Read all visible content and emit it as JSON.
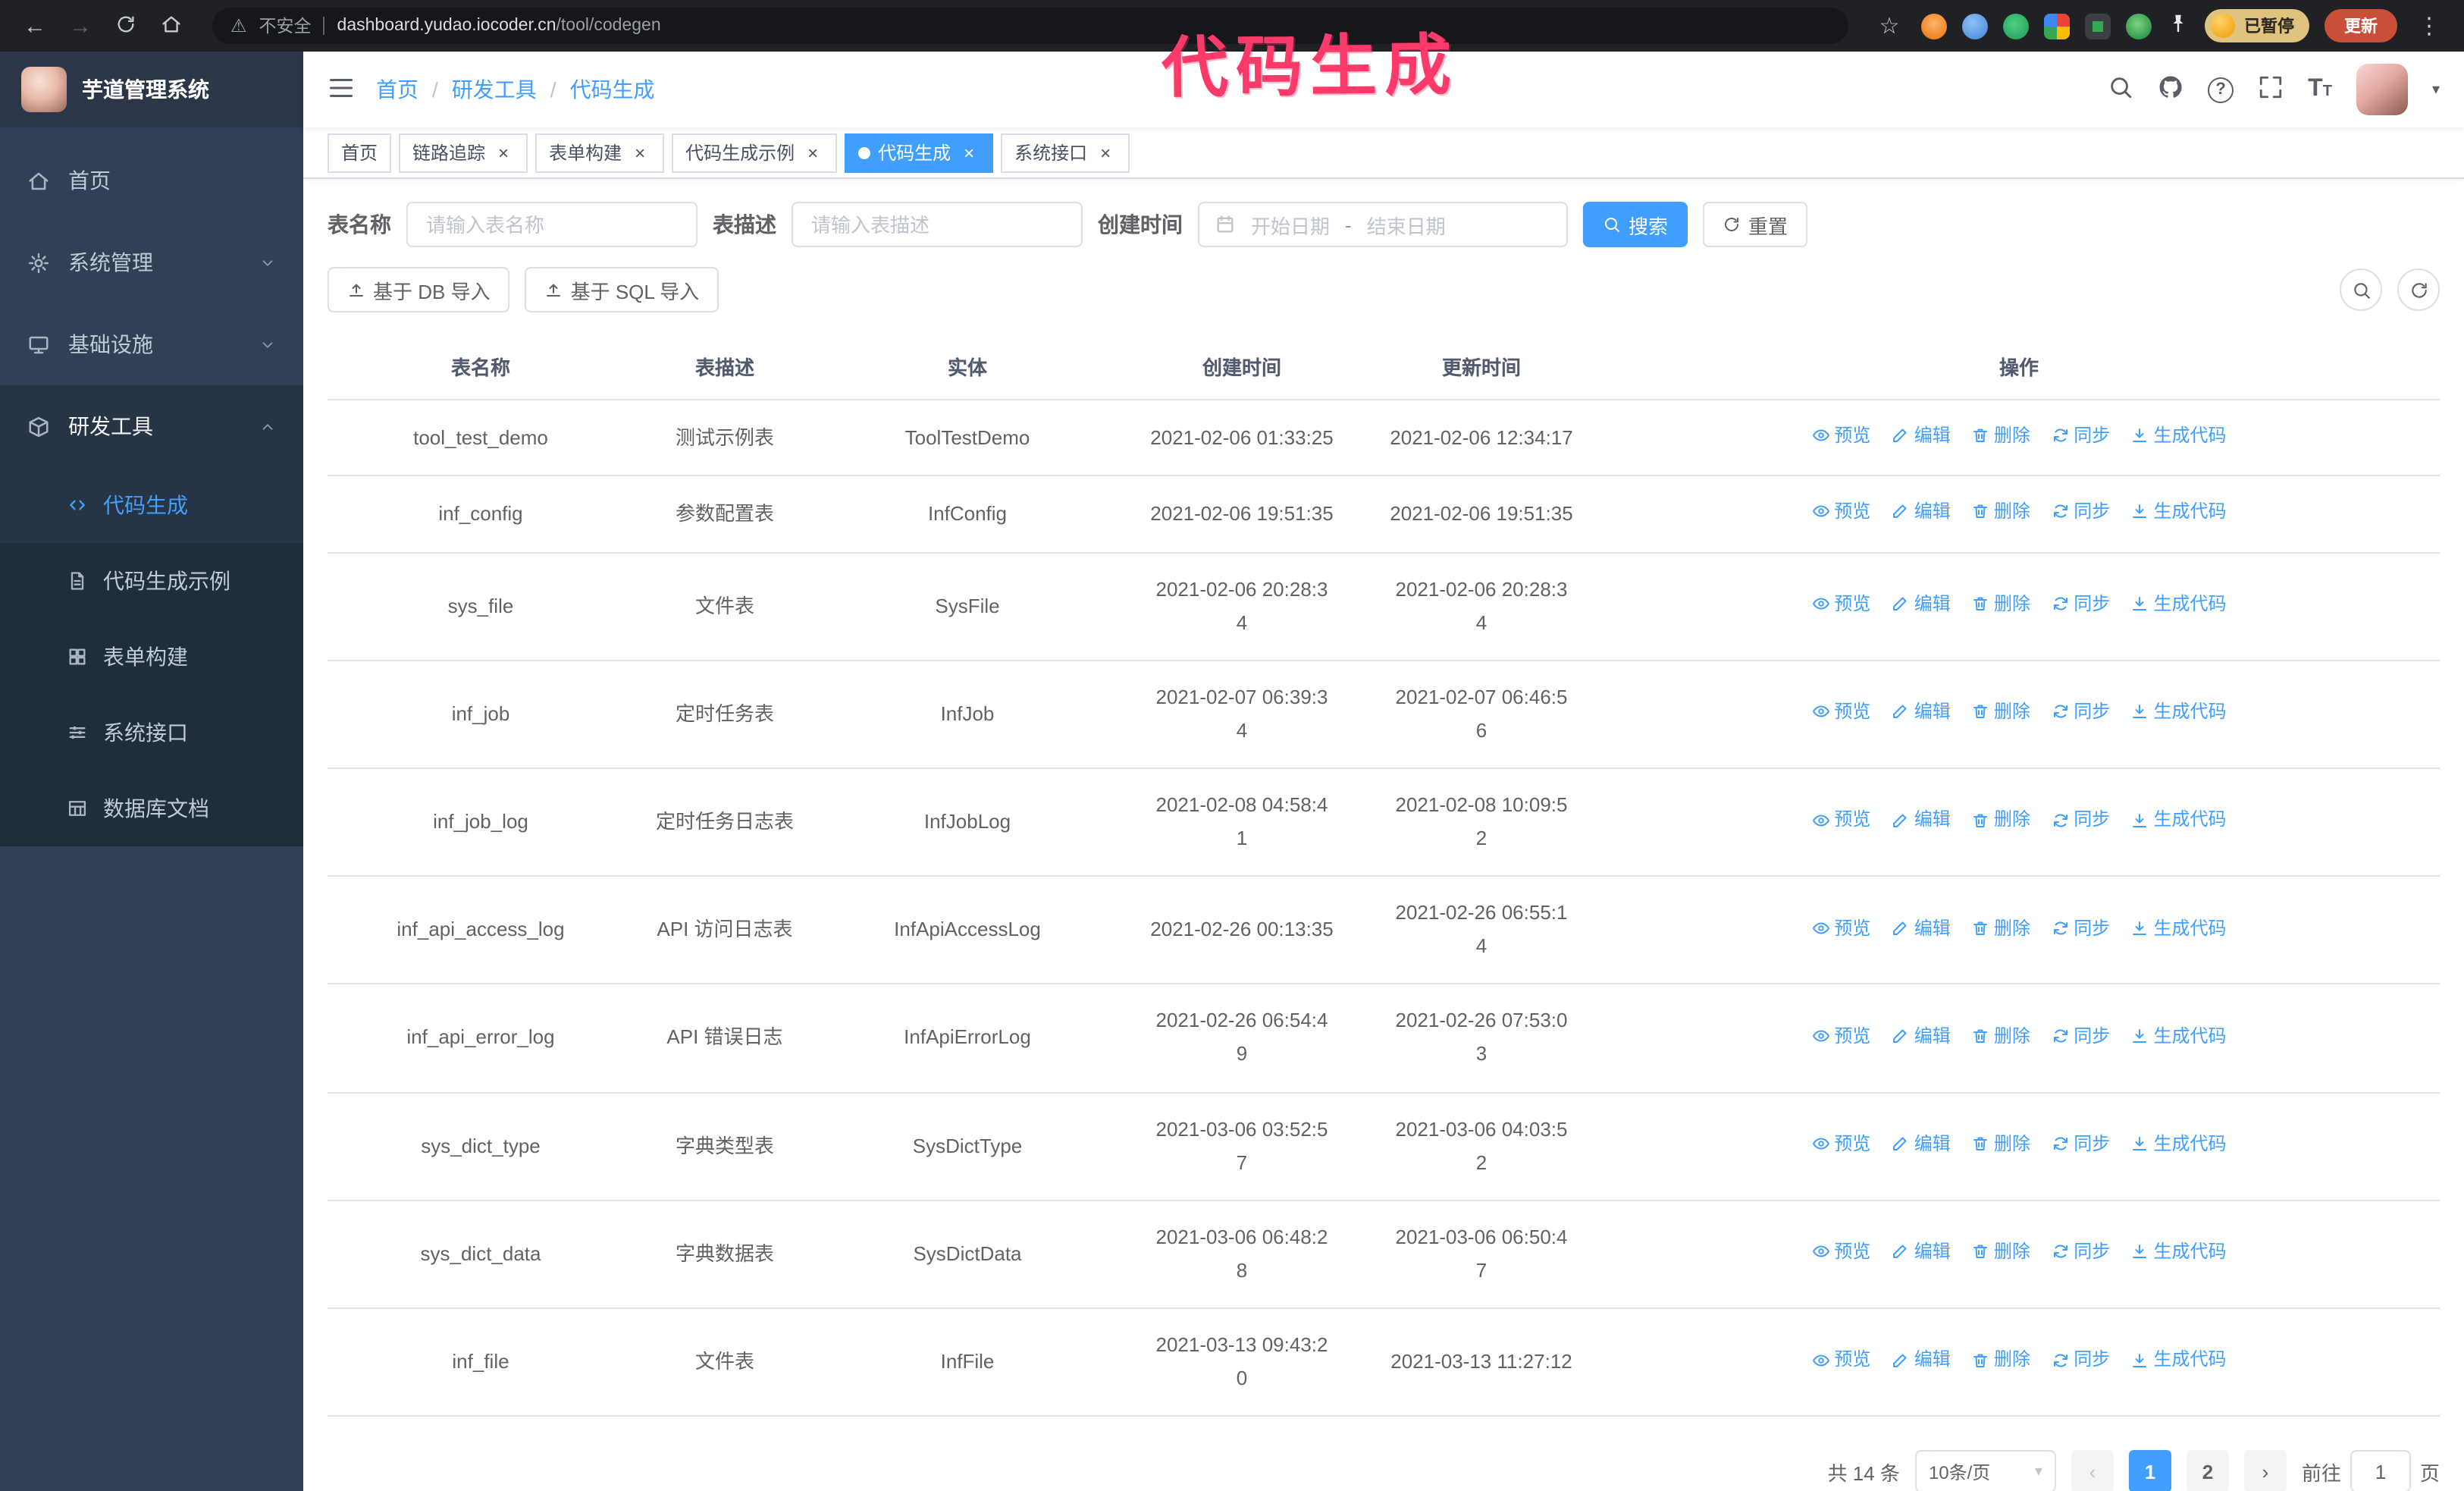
{
  "annotation": {
    "text": "代码生成",
    "color": "#fb3a6a"
  },
  "browser": {
    "security_label": "不安全",
    "url_host": "dashboard.yudao.iocoder.cn",
    "url_path": "/tool/codegen",
    "profile_badge": "已暂停",
    "update_button": "更新"
  },
  "glyphs": {
    "back": "←",
    "forward": "→",
    "star": "☆",
    "kebab": "⋮",
    "warning": "⚠",
    "close": "×",
    "caret_down": "▾",
    "prev": "‹",
    "next": "›",
    "question": "?",
    "fontsize_large": "T",
    "fontsize_small": "T"
  },
  "sidebar": {
    "app_title": "芋道管理系统",
    "menu": [
      {
        "label": "首页",
        "icon": "home-icon"
      },
      {
        "label": "系统管理",
        "icon": "gear-icon",
        "arrow": "down"
      },
      {
        "label": "基础设施",
        "icon": "monitor-icon",
        "arrow": "down"
      },
      {
        "label": "研发工具",
        "icon": "toolbox-icon",
        "arrow": "up",
        "expanded": true
      }
    ],
    "submenu": [
      {
        "label": "代码生成",
        "icon": "code-icon",
        "active": true
      },
      {
        "label": "代码生成示例",
        "icon": "document-icon"
      },
      {
        "label": "表单构建",
        "icon": "grid-icon"
      },
      {
        "label": "系统接口",
        "icon": "sliders-icon"
      },
      {
        "label": "数据库文档",
        "icon": "table-icon"
      }
    ]
  },
  "navbar": {
    "breadcrumb": [
      "首页",
      "研发工具",
      "代码生成"
    ],
    "separator": "/"
  },
  "tags": [
    {
      "label": "首页",
      "closable": false,
      "active": false
    },
    {
      "label": "链路追踪",
      "closable": true,
      "active": false
    },
    {
      "label": "表单构建",
      "closable": true,
      "active": false
    },
    {
      "label": "代码生成示例",
      "closable": true,
      "active": false
    },
    {
      "label": "代码生成",
      "closable": true,
      "active": true
    },
    {
      "label": "系统接口",
      "closable": true,
      "active": false
    }
  ],
  "filters": {
    "name_label": "表名称",
    "name_placeholder": "请输入表名称",
    "desc_label": "表描述",
    "desc_placeholder": "请输入表描述",
    "time_label": "创建时间",
    "start_placeholder": "开始日期",
    "range_separator": "-",
    "end_placeholder": "结束日期",
    "search_button": "搜索",
    "reset_button": "重置"
  },
  "toolbar": {
    "db_import_button": "基于 DB 导入",
    "sql_import_button": "基于 SQL 导入"
  },
  "table": {
    "headers": [
      "表名称",
      "表描述",
      "实体",
      "创建时间",
      "更新时间",
      "操作"
    ],
    "row_actions": [
      {
        "label": "预览",
        "icon": "eye-icon"
      },
      {
        "label": "编辑",
        "icon": "edit-icon"
      },
      {
        "label": "删除",
        "icon": "trash-icon"
      },
      {
        "label": "同步",
        "icon": "sync-icon"
      },
      {
        "label": "生成代码",
        "icon": "download-icon"
      }
    ],
    "rows": [
      {
        "name": "tool_test_demo",
        "description": "测试示例表",
        "entity": "ToolTestDemo",
        "created": "2021-02-06 01:33:25",
        "updated": "2021-02-06 12:34:17"
      },
      {
        "name": "inf_config",
        "description": "参数配置表",
        "entity": "InfConfig",
        "created": "2021-02-06 19:51:35",
        "updated": "2021-02-06 19:51:35"
      },
      {
        "name": "sys_file",
        "description": "文件表",
        "entity": "SysFile",
        "created": "2021-02-06 20:28:3\n4",
        "updated": "2021-02-06 20:28:3\n4"
      },
      {
        "name": "inf_job",
        "description": "定时任务表",
        "entity": "InfJob",
        "created": "2021-02-07 06:39:3\n4",
        "updated": "2021-02-07 06:46:5\n6"
      },
      {
        "name": "inf_job_log",
        "description": "定时任务日志表",
        "entity": "InfJobLog",
        "created": "2021-02-08 04:58:4\n1",
        "updated": "2021-02-08 10:09:5\n2"
      },
      {
        "name": "inf_api_access_log",
        "description": "API 访问日志表",
        "entity": "InfApiAccessLog",
        "created": "2021-02-26 00:13:35",
        "updated": "2021-02-26 06:55:1\n4"
      },
      {
        "name": "inf_api_error_log",
        "description": "API 错误日志",
        "entity": "InfApiErrorLog",
        "created": "2021-02-26 06:54:4\n9",
        "updated": "2021-02-26 07:53:0\n3"
      },
      {
        "name": "sys_dict_type",
        "description": "字典类型表",
        "entity": "SysDictType",
        "created": "2021-03-06 03:52:5\n7",
        "updated": "2021-03-06 04:03:5\n2"
      },
      {
        "name": "sys_dict_data",
        "description": "字典数据表",
        "entity": "SysDictData",
        "created": "2021-03-06 06:48:2\n8",
        "updated": "2021-03-06 06:50:4\n7"
      },
      {
        "name": "inf_file",
        "description": "文件表",
        "entity": "InfFile",
        "created": "2021-03-13 09:43:2\n0",
        "updated": "2021-03-13 11:27:12"
      }
    ]
  },
  "pagination": {
    "total_text": "共 14 条",
    "page_size": "10条/页",
    "pages": [
      "1",
      "2"
    ],
    "active_page": "1",
    "goto_label": "前往",
    "goto_value": "1",
    "goto_suffix": "页"
  },
  "theme": {
    "accent": "#409eff",
    "sidebar_bg": "#304156",
    "submenu_bg": "#1f2d3d",
    "chrome_bg": "#202124",
    "annotation_color": "#fb3a6a",
    "update_button_bg": "#c94f38"
  }
}
